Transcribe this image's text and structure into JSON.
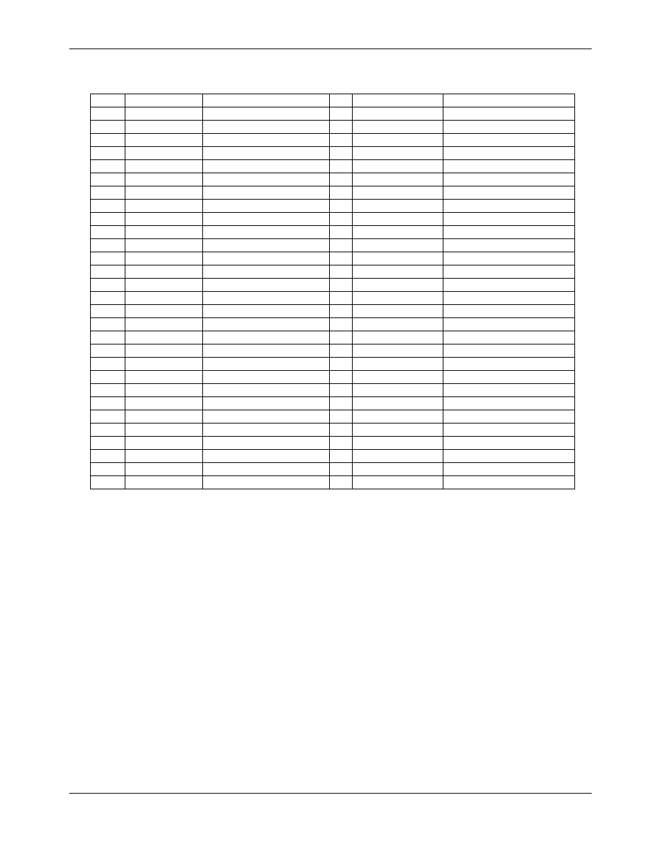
{
  "table": {
    "rows": 30,
    "cols": 6
  }
}
